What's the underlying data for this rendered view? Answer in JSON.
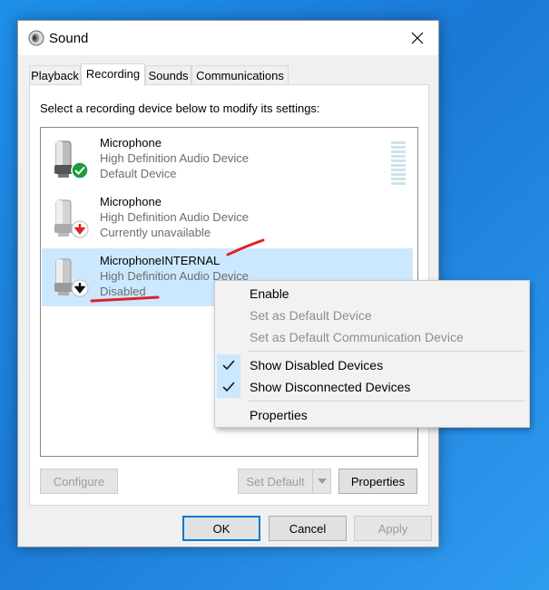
{
  "window": {
    "title": "Sound",
    "icon": "speaker-icon"
  },
  "tabs": [
    {
      "label": "Playback",
      "active": false
    },
    {
      "label": "Recording",
      "active": true
    },
    {
      "label": "Sounds",
      "active": false
    },
    {
      "label": "Communications",
      "active": false
    }
  ],
  "instruction": "Select a recording device below to modify its settings:",
  "devices": [
    {
      "name": "Microphone",
      "driver": "High Definition Audio Device",
      "status": "Default Device",
      "badge": "green-check-icon"
    },
    {
      "name": "Microphone",
      "driver": "High Definition Audio Device",
      "status": "Currently unavailable",
      "badge": "red-down-arrow-icon"
    },
    {
      "name": "MicrophoneINTERNAL",
      "driver": "High Definition Audio Device",
      "status": "Disabled",
      "badge": "black-down-arrow-icon",
      "selected": true
    }
  ],
  "buttons": {
    "configure": "Configure",
    "set_default": "Set Default",
    "properties": "Properties",
    "ok": "OK",
    "cancel": "Cancel",
    "apply": "Apply"
  },
  "context_menu": {
    "items": [
      {
        "label": "Enable",
        "enabled": true
      },
      {
        "label": "Set as Default Device",
        "enabled": false
      },
      {
        "label": "Set as Default Communication Device",
        "enabled": false
      },
      {
        "label": "Show Disabled Devices",
        "enabled": true,
        "checked": true
      },
      {
        "label": "Show Disconnected Devices",
        "enabled": true,
        "checked": true
      },
      {
        "label": "Properties",
        "enabled": true
      }
    ]
  },
  "colors": {
    "selection": "#cce8ff",
    "accent": "#0078d7",
    "annotation": "#e0202a",
    "desktop": "#1b79d6"
  }
}
